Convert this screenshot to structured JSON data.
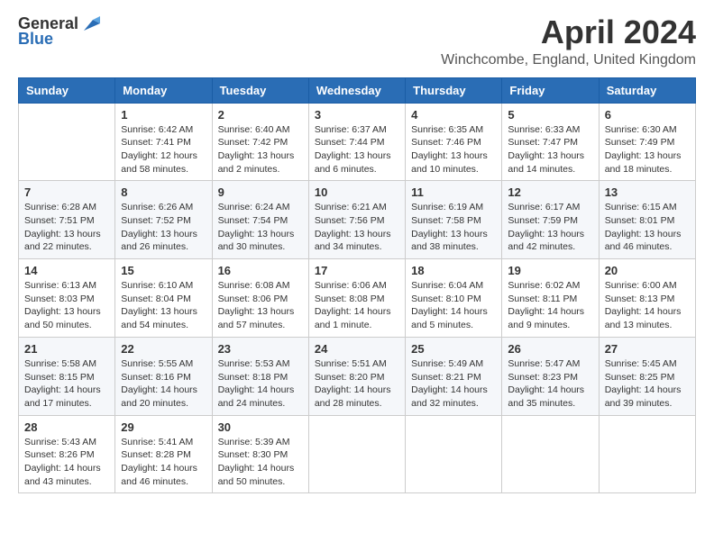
{
  "logo": {
    "text_general": "General",
    "text_blue": "Blue"
  },
  "title": "April 2024",
  "location": "Winchcombe, England, United Kingdom",
  "days_of_week": [
    "Sunday",
    "Monday",
    "Tuesday",
    "Wednesday",
    "Thursday",
    "Friday",
    "Saturday"
  ],
  "weeks": [
    [
      {
        "day": "",
        "info": ""
      },
      {
        "day": "1",
        "info": "Sunrise: 6:42 AM\nSunset: 7:41 PM\nDaylight: 12 hours\nand 58 minutes."
      },
      {
        "day": "2",
        "info": "Sunrise: 6:40 AM\nSunset: 7:42 PM\nDaylight: 13 hours\nand 2 minutes."
      },
      {
        "day": "3",
        "info": "Sunrise: 6:37 AM\nSunset: 7:44 PM\nDaylight: 13 hours\nand 6 minutes."
      },
      {
        "day": "4",
        "info": "Sunrise: 6:35 AM\nSunset: 7:46 PM\nDaylight: 13 hours\nand 10 minutes."
      },
      {
        "day": "5",
        "info": "Sunrise: 6:33 AM\nSunset: 7:47 PM\nDaylight: 13 hours\nand 14 minutes."
      },
      {
        "day": "6",
        "info": "Sunrise: 6:30 AM\nSunset: 7:49 PM\nDaylight: 13 hours\nand 18 minutes."
      }
    ],
    [
      {
        "day": "7",
        "info": "Sunrise: 6:28 AM\nSunset: 7:51 PM\nDaylight: 13 hours\nand 22 minutes."
      },
      {
        "day": "8",
        "info": "Sunrise: 6:26 AM\nSunset: 7:52 PM\nDaylight: 13 hours\nand 26 minutes."
      },
      {
        "day": "9",
        "info": "Sunrise: 6:24 AM\nSunset: 7:54 PM\nDaylight: 13 hours\nand 30 minutes."
      },
      {
        "day": "10",
        "info": "Sunrise: 6:21 AM\nSunset: 7:56 PM\nDaylight: 13 hours\nand 34 minutes."
      },
      {
        "day": "11",
        "info": "Sunrise: 6:19 AM\nSunset: 7:58 PM\nDaylight: 13 hours\nand 38 minutes."
      },
      {
        "day": "12",
        "info": "Sunrise: 6:17 AM\nSunset: 7:59 PM\nDaylight: 13 hours\nand 42 minutes."
      },
      {
        "day": "13",
        "info": "Sunrise: 6:15 AM\nSunset: 8:01 PM\nDaylight: 13 hours\nand 46 minutes."
      }
    ],
    [
      {
        "day": "14",
        "info": "Sunrise: 6:13 AM\nSunset: 8:03 PM\nDaylight: 13 hours\nand 50 minutes."
      },
      {
        "day": "15",
        "info": "Sunrise: 6:10 AM\nSunset: 8:04 PM\nDaylight: 13 hours\nand 54 minutes."
      },
      {
        "day": "16",
        "info": "Sunrise: 6:08 AM\nSunset: 8:06 PM\nDaylight: 13 hours\nand 57 minutes."
      },
      {
        "day": "17",
        "info": "Sunrise: 6:06 AM\nSunset: 8:08 PM\nDaylight: 14 hours\nand 1 minute."
      },
      {
        "day": "18",
        "info": "Sunrise: 6:04 AM\nSunset: 8:10 PM\nDaylight: 14 hours\nand 5 minutes."
      },
      {
        "day": "19",
        "info": "Sunrise: 6:02 AM\nSunset: 8:11 PM\nDaylight: 14 hours\nand 9 minutes."
      },
      {
        "day": "20",
        "info": "Sunrise: 6:00 AM\nSunset: 8:13 PM\nDaylight: 14 hours\nand 13 minutes."
      }
    ],
    [
      {
        "day": "21",
        "info": "Sunrise: 5:58 AM\nSunset: 8:15 PM\nDaylight: 14 hours\nand 17 minutes."
      },
      {
        "day": "22",
        "info": "Sunrise: 5:55 AM\nSunset: 8:16 PM\nDaylight: 14 hours\nand 20 minutes."
      },
      {
        "day": "23",
        "info": "Sunrise: 5:53 AM\nSunset: 8:18 PM\nDaylight: 14 hours\nand 24 minutes."
      },
      {
        "day": "24",
        "info": "Sunrise: 5:51 AM\nSunset: 8:20 PM\nDaylight: 14 hours\nand 28 minutes."
      },
      {
        "day": "25",
        "info": "Sunrise: 5:49 AM\nSunset: 8:21 PM\nDaylight: 14 hours\nand 32 minutes."
      },
      {
        "day": "26",
        "info": "Sunrise: 5:47 AM\nSunset: 8:23 PM\nDaylight: 14 hours\nand 35 minutes."
      },
      {
        "day": "27",
        "info": "Sunrise: 5:45 AM\nSunset: 8:25 PM\nDaylight: 14 hours\nand 39 minutes."
      }
    ],
    [
      {
        "day": "28",
        "info": "Sunrise: 5:43 AM\nSunset: 8:26 PM\nDaylight: 14 hours\nand 43 minutes."
      },
      {
        "day": "29",
        "info": "Sunrise: 5:41 AM\nSunset: 8:28 PM\nDaylight: 14 hours\nand 46 minutes."
      },
      {
        "day": "30",
        "info": "Sunrise: 5:39 AM\nSunset: 8:30 PM\nDaylight: 14 hours\nand 50 minutes."
      },
      {
        "day": "",
        "info": ""
      },
      {
        "day": "",
        "info": ""
      },
      {
        "day": "",
        "info": ""
      },
      {
        "day": "",
        "info": ""
      }
    ]
  ]
}
